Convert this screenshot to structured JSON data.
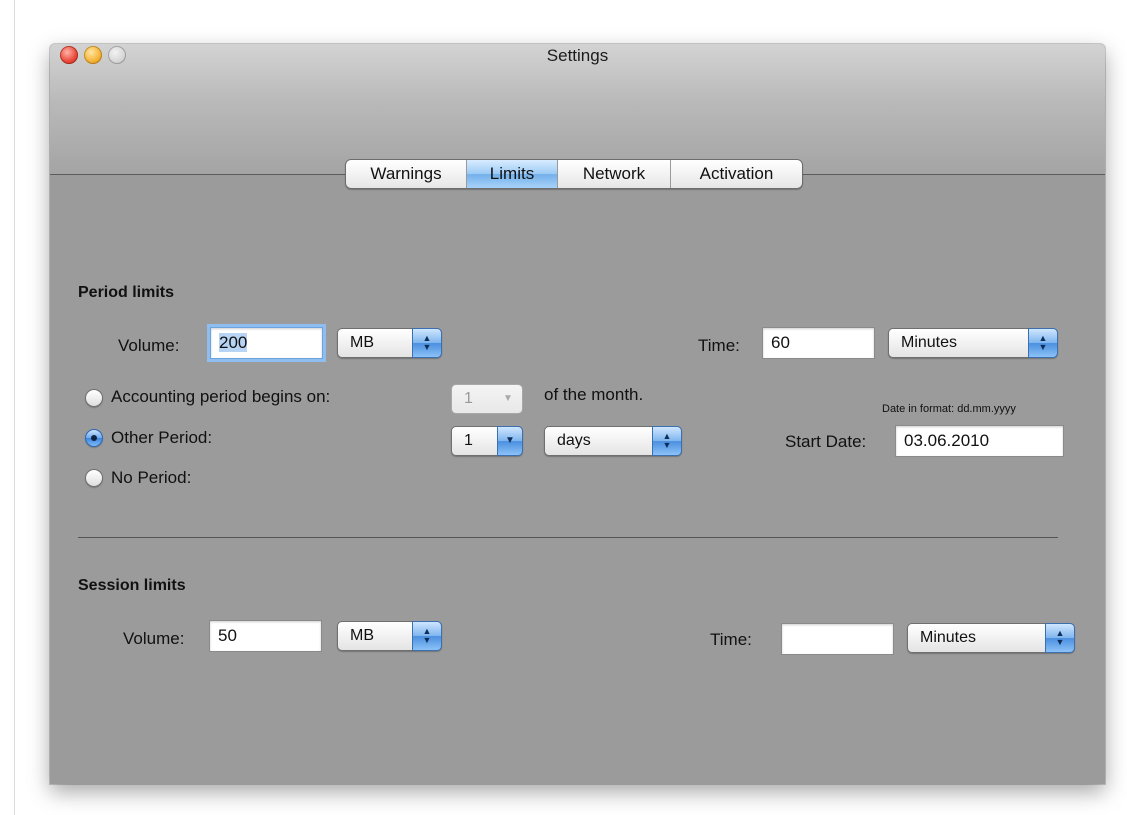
{
  "window": {
    "title": "Settings"
  },
  "tabs": [
    {
      "label": "Warnings",
      "selected": false
    },
    {
      "label": "Limits",
      "selected": true
    },
    {
      "label": "Network",
      "selected": false
    },
    {
      "label": "Activation",
      "selected": false
    }
  ],
  "period_limits": {
    "title": "Period limits",
    "volume_label": "Volume:",
    "volume_value": "200",
    "volume_unit": "MB",
    "time_label": "Time:",
    "time_value": "60",
    "time_unit": "Minutes",
    "accounting_label": "Accounting period begins on:",
    "accounting_day": "1",
    "accounting_suffix": "of the month.",
    "other_period_label": "Other Period:",
    "other_period_count": "1",
    "other_period_unit": "days",
    "no_period_label": "No Period:",
    "date_format_note": "Date in format: dd.mm.yyyy",
    "start_date_label": "Start Date:",
    "start_date_value": "03.06.2010",
    "selected_option": "Other Period"
  },
  "session_limits": {
    "title": "Session limits",
    "volume_label": "Volume:",
    "volume_value": "50",
    "volume_unit": "MB",
    "time_label": "Time:",
    "time_value": "",
    "time_unit": "Minutes"
  },
  "icons": {
    "stepper": "up-down-arrows",
    "dropdown": "down-arrow"
  },
  "colors": {
    "window_bg": "#9b9b9b",
    "accent": "#4a8fe0",
    "close": "#ea4c3c",
    "minimize": "#f5b53a"
  }
}
